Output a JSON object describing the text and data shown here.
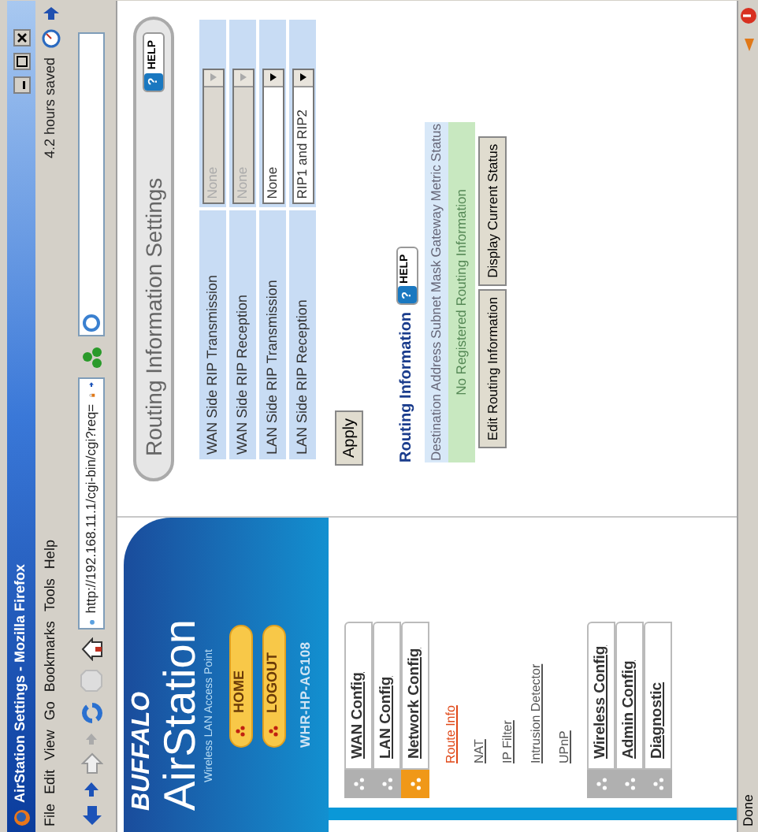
{
  "window": {
    "title": "AirStation Settings - Mozilla Firefox"
  },
  "menu_bar": {
    "items": [
      "File",
      "Edit",
      "View",
      "Go",
      "Bookmarks",
      "Tools",
      "Help"
    ],
    "notice": "4.2 hours saved"
  },
  "toolbar": {
    "url": "http://192.168.11.1/cgi-bin/cgi?req="
  },
  "sidebar": {
    "logo": "BUFFALO",
    "product": "AirStation",
    "tagline": "Wireless LAN Access Point",
    "buttons": [
      "HOME",
      "LOGOUT"
    ],
    "model": "WHR-HP-AG108",
    "menu": [
      {
        "label": "WAN Config",
        "selected": false
      },
      {
        "label": "LAN Config",
        "selected": false
      },
      {
        "label": "Network Config",
        "selected": true,
        "children": [
          {
            "label": "Route Info",
            "selected": true
          },
          {
            "label": "NAT",
            "selected": false
          },
          {
            "label": "IP Filter",
            "selected": false
          },
          {
            "label": "Intrusion Detector",
            "selected": false
          },
          {
            "label": "UPnP",
            "selected": false
          }
        ]
      },
      {
        "label": "Wireless Config",
        "selected": false
      },
      {
        "label": "Admin Config",
        "selected": false
      },
      {
        "label": "Diagnostic",
        "selected": false
      }
    ]
  },
  "settings": {
    "title": "Routing Information Settings",
    "help": {
      "mark": "?",
      "label": "HELP"
    },
    "rows": [
      {
        "label": "WAN Side RIP Transmission",
        "value": "None",
        "disabled": true
      },
      {
        "label": "WAN Side RIP Reception",
        "value": "None",
        "disabled": true
      },
      {
        "label": "LAN Side RIP Transmission",
        "value": "None",
        "disabled": false
      },
      {
        "label": "LAN Side RIP Reception",
        "value": "RIP1 and RIP2",
        "disabled": false
      }
    ],
    "apply": "Apply"
  },
  "routing": {
    "title": "Routing Information",
    "help": {
      "mark": "?",
      "label": "HELP"
    },
    "columns": [
      "Destination Address",
      "Subnet Mask",
      "Gateway",
      "Metric",
      "Status"
    ],
    "empty_message": "No Registered Routing Information",
    "buttons": [
      "Edit Routing Information",
      "Display Current Status"
    ]
  },
  "status_bar": {
    "text": "Done"
  }
}
